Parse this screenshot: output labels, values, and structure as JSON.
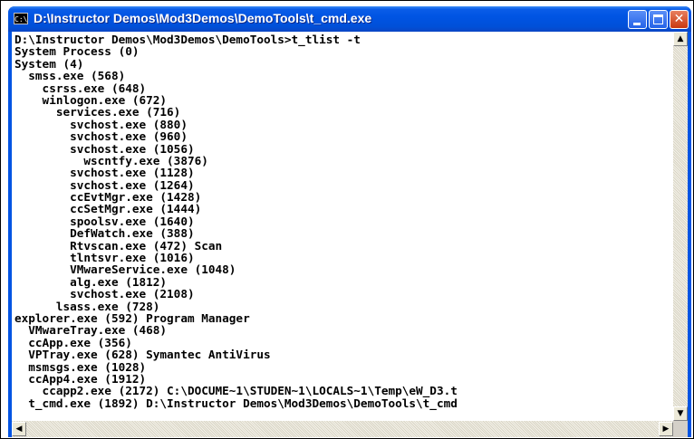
{
  "window": {
    "title": "D:\\Instructor Demos\\Mod3Demos\\DemoTools\\t_cmd.exe",
    "icon_label": "C:\\",
    "controls": {
      "minimize": "minimize-icon",
      "maximize": "maximize-icon",
      "close": "close-icon",
      "close_glyph": "✕"
    }
  },
  "console": {
    "lines": [
      "D:\\Instructor Demos\\Mod3Demos\\DemoTools>t_tlist -t",
      "System Process (0)",
      "System (4)",
      "  smss.exe (568)",
      "    csrss.exe (648)",
      "    winlogon.exe (672)",
      "      services.exe (716)",
      "        svchost.exe (880)",
      "        svchost.exe (960)",
      "        svchost.exe (1056)",
      "          wscntfy.exe (3876)",
      "        svchost.exe (1128)",
      "        svchost.exe (1264)",
      "        ccEvtMgr.exe (1428)",
      "        ccSetMgr.exe (1444)",
      "        spoolsv.exe (1640)",
      "        DefWatch.exe (388)",
      "        Rtvscan.exe (472) Scan",
      "        tlntsvr.exe (1016)",
      "        VMwareService.exe (1048)",
      "        alg.exe (1812)",
      "        svchost.exe (2108)",
      "      lsass.exe (728)",
      "explorer.exe (592) Program Manager",
      "  VMwareTray.exe (468)",
      "  ccApp.exe (356)",
      "  VPTray.exe (628) Symantec AntiVirus",
      "  msmsgs.exe (1028)",
      "  ccApp4.exe (1912)",
      "    ccapp2.exe (2172) C:\\DOCUME~1\\STUDEN~1\\LOCALS~1\\Temp\\eW_D3.t",
      "  t_cmd.exe (1892) D:\\Instructor Demos\\Mod3Demos\\DemoTools\\t_cmd"
    ]
  },
  "scrollbars": {
    "up_glyph": "▲",
    "down_glyph": "▼",
    "left_glyph": "◀",
    "right_glyph": "▶"
  },
  "colors": {
    "titlebar": "#0054e3",
    "console_background": "#ffffff",
    "console_text": "#000000",
    "close_button": "#c83810"
  }
}
